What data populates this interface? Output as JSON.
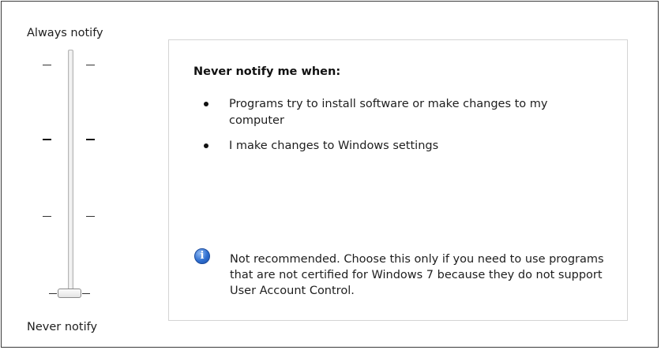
{
  "slider": {
    "top_label": "Always notify",
    "bottom_label": "Never notify",
    "levels": 4,
    "current_level": 1
  },
  "panel": {
    "title": "Never notify me when:",
    "bullets": [
      "Programs try to install software or make changes to my computer",
      "I make changes to Windows settings"
    ],
    "info_icon": "info-icon",
    "note": "Not recommended. Choose this only if you need to use programs that are not certified for Windows 7 because they do not support User Account Control."
  }
}
